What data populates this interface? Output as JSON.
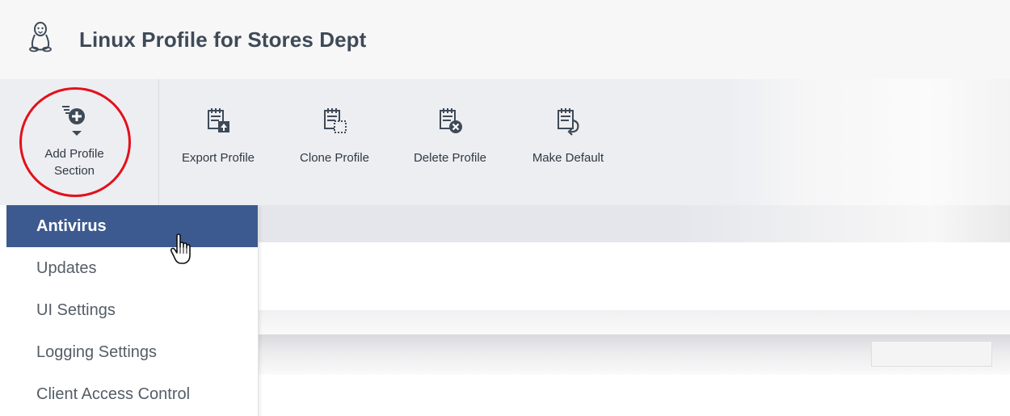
{
  "header": {
    "title": "Linux Profile for Stores Dept",
    "icon": "linux-penguin-icon"
  },
  "toolbar": {
    "add_profile_section": {
      "label_line1": "Add Profile",
      "label_line2": "Section",
      "icon": "add-circle-icon"
    },
    "buttons": [
      {
        "label": "Export Profile",
        "icon": "export-profile-icon"
      },
      {
        "label": "Clone Profile",
        "icon": "clone-profile-icon"
      },
      {
        "label": "Delete Profile",
        "icon": "delete-profile-icon"
      },
      {
        "label": "Make Default",
        "icon": "make-default-icon"
      }
    ]
  },
  "dropdown": {
    "items": [
      {
        "label": "Antivirus",
        "active": true
      },
      {
        "label": "Updates",
        "active": false
      },
      {
        "label": "UI Settings",
        "active": false
      },
      {
        "label": "Logging Settings",
        "active": false
      },
      {
        "label": "Client Access Control",
        "active": false
      }
    ]
  },
  "colors": {
    "accent": "#3c5a8f",
    "highlight_circle": "#e3101b",
    "icon": "#3f4a57",
    "title": "#3f4a57"
  }
}
